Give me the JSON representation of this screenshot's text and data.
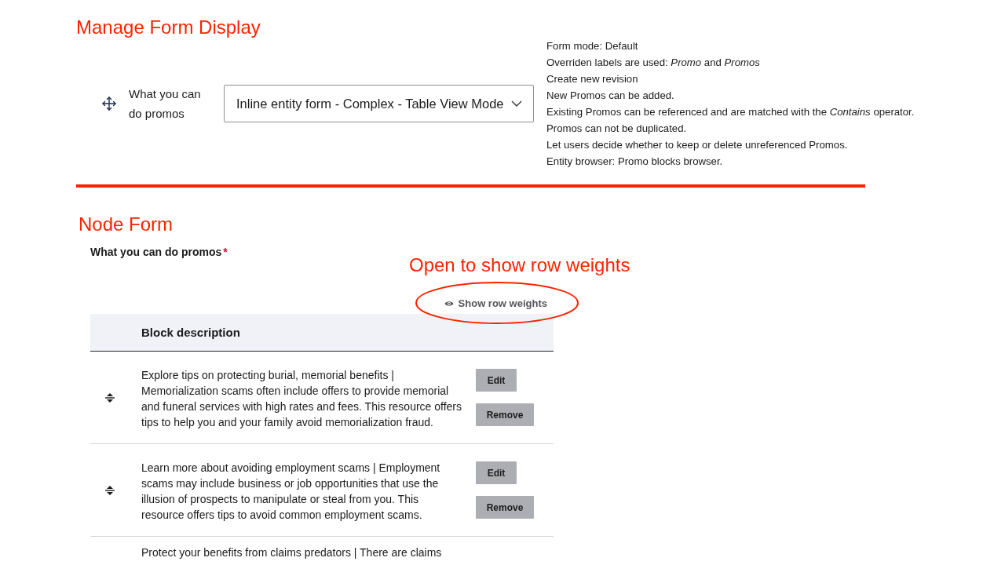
{
  "manage_form_display": {
    "heading": "Manage Form Display",
    "field_name": "What you can do promos",
    "widget_select": {
      "value": "Inline entity form - Complex - Table View Mode"
    },
    "summary": [
      "Form mode: Default",
      "Overriden labels are used: *Promo* and *Promos*",
      "Create new revision",
      "New Promos can be added.",
      "Existing Promos can be referenced and are matched with the *Contains* operator.",
      "Promos can not be duplicated.",
      "Let users decide whether to keep or delete unreferenced Promos.",
      "Entity browser: Promo blocks browser."
    ]
  },
  "node_form": {
    "heading": "Node Form",
    "field_label": "What you can do promos",
    "required_mark": "*",
    "annotation": "Open to show row weights",
    "show_row_weights_link": "Show row weights",
    "table": {
      "columns": [
        "Block description"
      ],
      "rows": [
        {
          "description": "Explore tips on protecting burial, memorial benefits | Memorialization scams often include offers to provide memorial and funeral services with high rates and fees. This resource offers tips to help you and your family avoid memorialization fraud.",
          "draggable": true,
          "buttons": [
            "Edit",
            "Remove"
          ]
        },
        {
          "description": "Learn more about avoiding employment scams | Employment scams may include business or job opportunities that use the illusion of prospects to manipulate or steal from you. This resource offers tips to avoid common employment scams.",
          "draggable": true,
          "buttons": [
            "Edit",
            "Remove"
          ]
        },
        {
          "description": "Protect your benefits from claims predators | There are claims"
        }
      ]
    }
  }
}
